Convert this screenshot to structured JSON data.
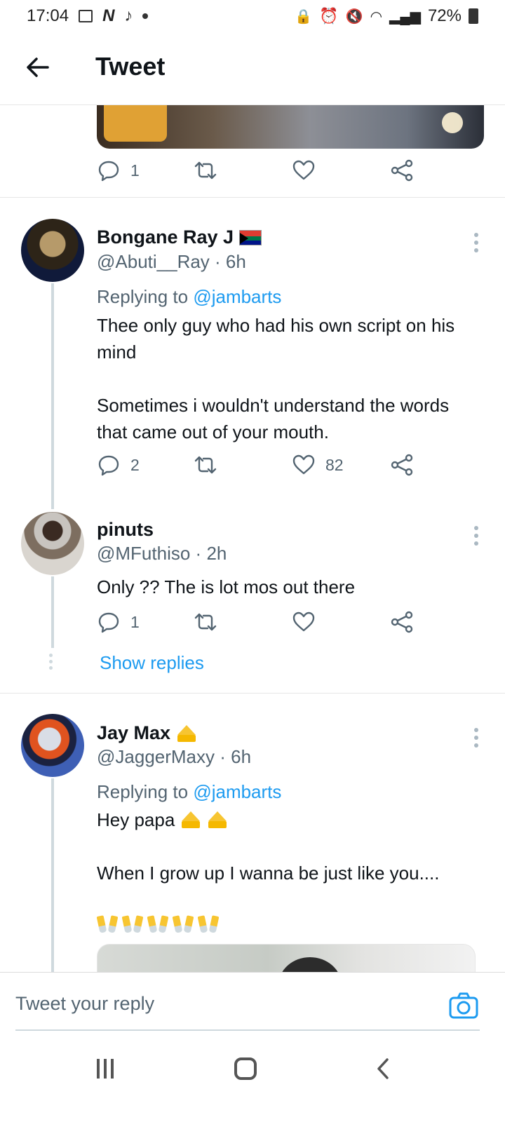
{
  "status_bar": {
    "time": "17:04",
    "battery": "72%"
  },
  "header": {
    "title": "Tweet"
  },
  "top_tweet": {
    "reply_count": "1"
  },
  "replies": [
    {
      "display_name": "Bongane Ray J",
      "handle": "@Abuti__Ray",
      "time": "6h",
      "replying_label": "Replying to",
      "replying_to": "@jambarts",
      "text": "Thee only guy who had his own script on his mind\n\nSometimes i wouldn't understand the words that came out of your mouth.",
      "reply_count": "2",
      "like_count": "82"
    },
    {
      "display_name": "pinuts",
      "handle": "@MFuthiso",
      "time": "2h",
      "text": "Only ?? The is lot mos out there",
      "reply_count": "1",
      "show_replies": "Show replies"
    },
    {
      "display_name": "Jay Max",
      "handle": "@JaggerMaxy",
      "time": "6h",
      "replying_label": "Replying to",
      "replying_to": "@jambarts",
      "text_line1": "Hey papa",
      "text_line2": "When I grow up I wanna be just like you...."
    }
  ],
  "composer": {
    "placeholder": "Tweet your reply"
  },
  "colors": {
    "accent": "#1d9bf0",
    "muted": "#536471"
  }
}
